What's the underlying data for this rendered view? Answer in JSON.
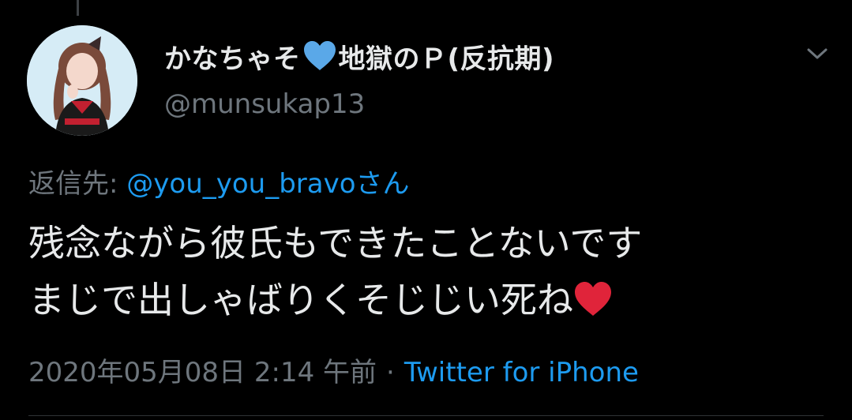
{
  "tweet": {
    "author": {
      "name_part1": "かなちゃそ",
      "name_part2": "地獄のＰ(反抗期)",
      "name_emoji_icon": "blue-heart-icon",
      "handle": "@munsukap13",
      "avatar_icon": "profile-avatar"
    },
    "reply": {
      "prefix": "返信先: ",
      "target": "@you_you_bravoさん"
    },
    "text_lines": [
      "残念ながら彼氏もできたことないです",
      "まじで出しゃばりくそじじい死ね"
    ],
    "text_end_emoji_icon": "red-heart-icon",
    "timestamp": "2020年05月08日 2:14 午前",
    "separator": "·",
    "client": "Twitter for iPhone"
  },
  "colors": {
    "background": "#000000",
    "primary_text": "#e7e9ea",
    "secondary_text": "#6e767d",
    "link": "#1d9bf0",
    "blue_heart": "#5aa8e8",
    "red_heart": "#e0243a"
  }
}
